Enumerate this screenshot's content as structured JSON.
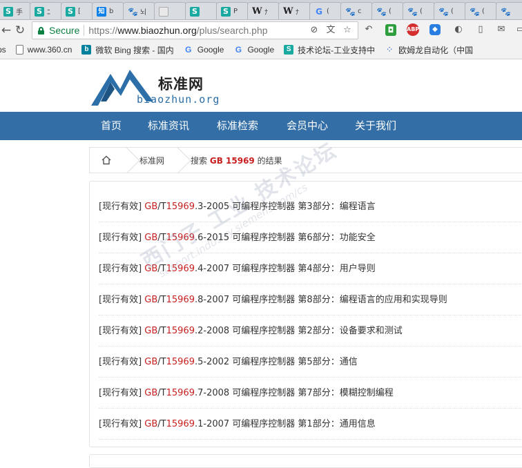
{
  "browser": {
    "tabs": [
      {
        "icon": "S",
        "kind": "s",
        "title": "手"
      },
      {
        "icon": "S",
        "kind": "s",
        "title": "ﾆ"
      },
      {
        "icon": "S",
        "kind": "s",
        "title": "["
      },
      {
        "icon": "知",
        "kind": "z",
        "title": "b"
      },
      {
        "icon": "🐾",
        "kind": "paw",
        "title": "뇌"
      },
      {
        "icon": "",
        "kind": "blank",
        "title": ""
      },
      {
        "icon": "S",
        "kind": "s",
        "title": ""
      },
      {
        "icon": "S",
        "kind": "s",
        "title": "P"
      },
      {
        "icon": "W",
        "kind": "w",
        "title": "ﾅ"
      },
      {
        "icon": "W",
        "kind": "w",
        "title": "ﾅ"
      },
      {
        "icon": "G",
        "kind": "g",
        "title": "("
      },
      {
        "icon": "🐾",
        "kind": "paw",
        "title": "c"
      },
      {
        "icon": "🐾",
        "kind": "paw",
        "title": "("
      },
      {
        "icon": "🐾",
        "kind": "paw",
        "title": "("
      },
      {
        "icon": "🐾",
        "kind": "paw",
        "title": "("
      },
      {
        "icon": "🐾",
        "kind": "paw",
        "title": "("
      },
      {
        "icon": "🐾",
        "kind": "paw",
        "title": ""
      }
    ],
    "secure_label": "Secure",
    "url_scheme": "https://",
    "url_host": "www.biaozhun.org",
    "url_path": "/plus/search.php",
    "bookmarks": [
      {
        "icon": "",
        "kind": "none",
        "label": "ps"
      },
      {
        "icon": "",
        "kind": "page",
        "label": "www.360.cn"
      },
      {
        "icon": "b",
        "kind": "bing",
        "label": "微软 Bing 搜索 - 国内"
      },
      {
        "icon": "G",
        "kind": "goo",
        "label": "Google"
      },
      {
        "icon": "G",
        "kind": "goo",
        "label": "Google"
      },
      {
        "icon": "S",
        "kind": "ss",
        "label": "技术论坛-工业支持中"
      },
      {
        "icon": "⁘",
        "kind": "grid",
        "label": "欧姆龙自动化（中国"
      }
    ]
  },
  "site": {
    "logo_cn": "标准网",
    "logo_en": "biaozhun.org",
    "nav": [
      "首页",
      "标准资讯",
      "标准检索",
      "会员中心",
      "关于我们"
    ],
    "breadcrumb": {
      "home_crumb": "标准网",
      "search_prefix": "搜索",
      "search_term": "GB 15969",
      "search_suffix": "的结果"
    },
    "results": [
      {
        "status": "[现行有效]",
        "prefix": "GB",
        "slash": "/T",
        "code": "15969",
        "rest": ".3-2005 可编程序控制器 第3部分：编程语言"
      },
      {
        "status": "[现行有效]",
        "prefix": "GB",
        "slash": "/T",
        "code": "15969",
        "rest": ".6-2015 可编程序控制器 第6部分：功能安全"
      },
      {
        "status": "[现行有效]",
        "prefix": "GB",
        "slash": "/T",
        "code": "15969",
        "rest": ".4-2007 可编程序控制器 第4部分：用户导则"
      },
      {
        "status": "[现行有效]",
        "prefix": "GB",
        "slash": "/T",
        "code": "15969",
        "rest": ".8-2007 可编程序控制器 第8部分：编程语言的应用和实现导则"
      },
      {
        "status": "[现行有效]",
        "prefix": "GB",
        "slash": "/T",
        "code": "15969",
        "rest": ".2-2008 可编程序控制器 第2部分：设备要求和测试"
      },
      {
        "status": "[现行有效]",
        "prefix": "GB",
        "slash": "/T",
        "code": "15969",
        "rest": ".5-2002 可编程序控制器 第5部分：通信"
      },
      {
        "status": "[现行有效]",
        "prefix": "GB",
        "slash": "/T",
        "code": "15969",
        "rest": ".7-2008 可编程序控制器 第7部分：模糊控制编程"
      },
      {
        "status": "[现行有效]",
        "prefix": "GB",
        "slash": "/T",
        "code": "15969",
        "rest": ".1-2007 可编程序控制器 第1部分：通用信息"
      }
    ],
    "watermark": {
      "cn": "西门子 工业 技术论坛",
      "en": "support.industry.siemens.com/cs"
    }
  }
}
